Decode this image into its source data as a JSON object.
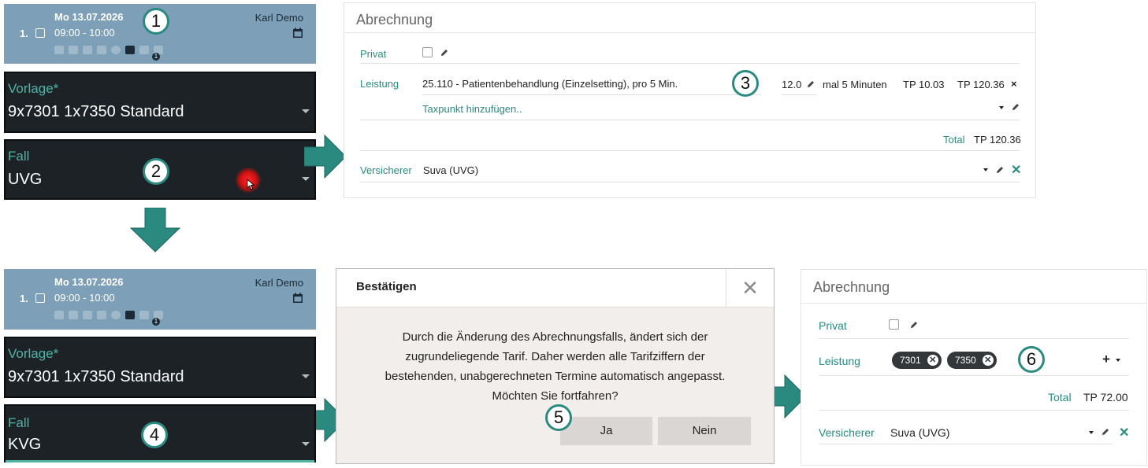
{
  "top": {
    "appointment": {
      "date": "Mo 13.07.2026",
      "time": "09:00 - 10:00",
      "number": "1.",
      "person": "Karl Demo",
      "badge": "1"
    },
    "vorlage": {
      "label": "Vorlage*",
      "value": "9x7301 1x7350 Standard"
    },
    "fall": {
      "label": "Fall",
      "value": "UVG"
    },
    "markers": [
      "1",
      "2",
      "3"
    ]
  },
  "billing1": {
    "title": "Abrechnung",
    "privat_label": "Privat",
    "leistung_label": "Leistung",
    "service": "25.110 - Patientenbehandlung (Einzelsetting), pro 5 Min.",
    "quantity": "12.0",
    "unit": "mal 5 Minuten",
    "tp_single": "TP 10.03",
    "tp_total": "TP 120.36",
    "remove": "×",
    "add_taxpunkt": "Taxpunkt hinzufügen..",
    "total_label": "Total",
    "total_value": "TP 120.36",
    "versicherer_label": "Versicherer",
    "versicherer_value": "Suva (UVG)"
  },
  "bottom": {
    "appointment": {
      "date": "Mo 13.07.2026",
      "time": "09:00 - 10:00",
      "number": "1.",
      "person": "Karl Demo",
      "badge": "1"
    },
    "vorlage": {
      "label": "Vorlage*",
      "value": "9x7301 1x7350 Standard"
    },
    "fall": {
      "label": "Fall",
      "value": "KVG"
    },
    "markers": [
      "4",
      "5",
      "6"
    ]
  },
  "dialog": {
    "title": "Bestätigen",
    "close": "✕",
    "message_lines": [
      "Durch die Änderung des Abrechnungsfalls, ändert sich der",
      "zugrundeliegende Tarif. Daher werden alle Tarifziffern der",
      "bestehenden, unabgerechneten Termine automatisch angepasst.",
      "Möchten Sie fortfahren?"
    ],
    "yes": "Ja",
    "no": "Nein"
  },
  "billing2": {
    "title": "Abrechnung",
    "privat_label": "Privat",
    "leistung_label": "Leistung",
    "chips": [
      "7301",
      "7350"
    ],
    "add": "+",
    "total_label": "Total",
    "total_value": "TP 72.00",
    "versicherer_label": "Versicherer",
    "versicherer_value": "Suva (UVG)"
  },
  "colors": {
    "accent": "#2a8a80",
    "header_blue": "#7d9fb8",
    "dark_panel": "#1d2227"
  }
}
